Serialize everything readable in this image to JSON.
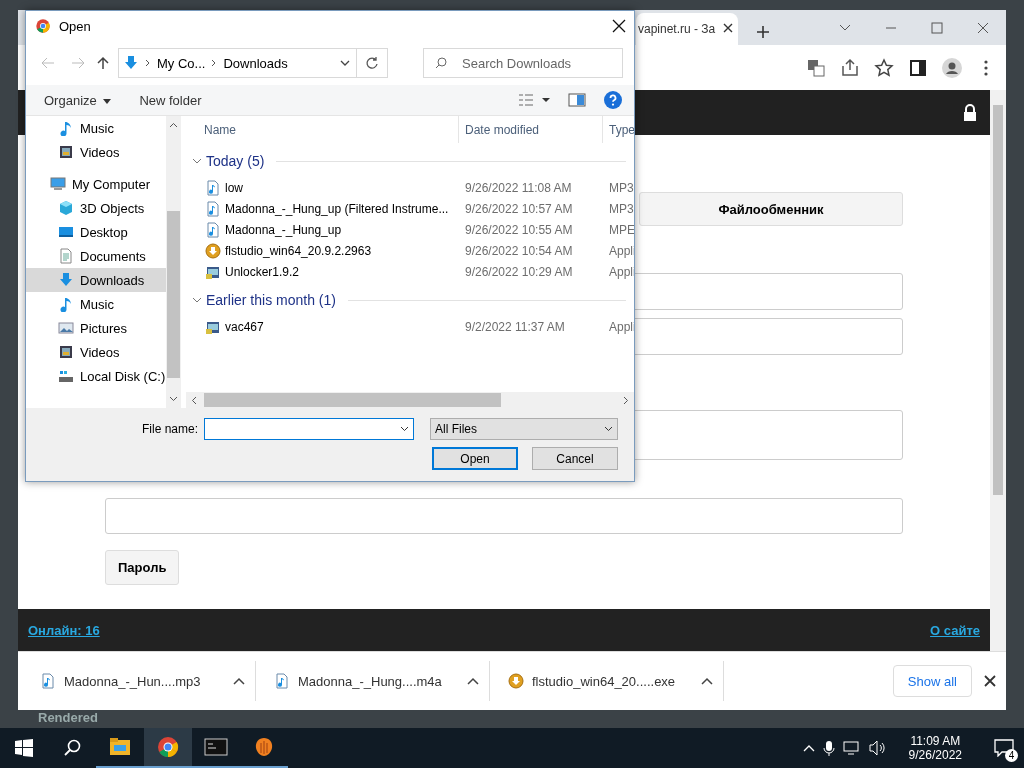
{
  "background_app": {
    "status_text": "Rendered"
  },
  "browser": {
    "tab": {
      "title": "vapinet.ru - За"
    },
    "page": {
      "tab_button": "Файлообменник",
      "password_button": "Пароль",
      "footer": {
        "online_link": "Онлайн: 16",
        "about_link": "О сайте"
      }
    },
    "downloads": {
      "items": [
        {
          "name": "Madonna_-_Hun....mp3",
          "kind": "audio"
        },
        {
          "name": "Madonna_-_Hung....m4a",
          "kind": "audio"
        },
        {
          "name": "flstudio_win64_20.....exe",
          "kind": "installer"
        }
      ],
      "show_all": "Show all"
    }
  },
  "dialog": {
    "title": "Open",
    "breadcrumb": [
      "My Co...",
      "Downloads"
    ],
    "search_placeholder": "Search Downloads",
    "toolbar": {
      "organize": "Organize",
      "new_folder": "New folder"
    },
    "nav": {
      "partial_children": [
        {
          "label": "Music",
          "kind": "music",
          "selected": false
        },
        {
          "label": "Videos",
          "kind": "videos",
          "selected": false
        }
      ],
      "items": [
        {
          "label": "My Computer",
          "kind": "computer",
          "selected": false,
          "children": [
            {
              "label": "3D Objects",
              "kind": "objects3d",
              "selected": false
            },
            {
              "label": "Desktop",
              "kind": "desktop",
              "selected": false
            },
            {
              "label": "Documents",
              "kind": "documents",
              "selected": false
            },
            {
              "label": "Downloads",
              "kind": "downloads",
              "selected": true
            },
            {
              "label": "Music",
              "kind": "music",
              "selected": false
            },
            {
              "label": "Pictures",
              "kind": "pictures",
              "selected": false
            },
            {
              "label": "Videos",
              "kind": "videos",
              "selected": false
            },
            {
              "label": "Local Disk (C:)",
              "kind": "disk",
              "selected": false
            }
          ]
        }
      ]
    },
    "columns": [
      "Name",
      "Date modified",
      "Type"
    ],
    "groups": [
      {
        "title": "Today (5)",
        "expanded": true,
        "files": [
          {
            "name": "low",
            "date": "9/26/2022 11:08 AM",
            "type": "MP3",
            "kind": "audio"
          },
          {
            "name": "Madonna_-_Hung_up (Filtered Instrume...",
            "date": "9/26/2022 10:57 AM",
            "type": "MP3",
            "kind": "audio"
          },
          {
            "name": "Madonna_-_Hung_up",
            "date": "9/26/2022 10:55 AM",
            "type": "MPE",
            "kind": "audio"
          },
          {
            "name": "flstudio_win64_20.9.2.2963",
            "date": "9/26/2022 10:54 AM",
            "type": "Appli",
            "kind": "installer"
          },
          {
            "name": "Unlocker1.9.2",
            "date": "9/26/2022 10:29 AM",
            "type": "Appli",
            "kind": "program"
          }
        ]
      },
      {
        "title": "Earlier this month (1)",
        "expanded": true,
        "files": [
          {
            "name": "vac467",
            "date": "9/2/2022 11:37 AM",
            "type": "Appli",
            "kind": "program"
          }
        ]
      }
    ],
    "file_name_label": "File name:",
    "file_type": "All Files",
    "buttons": [
      "Open",
      "Cancel"
    ]
  },
  "taskbar": {
    "apps": [
      {
        "kind": "explorer",
        "active": false
      },
      {
        "kind": "chrome",
        "active": true
      },
      {
        "kind": "terminal",
        "active": false
      },
      {
        "kind": "flstudio",
        "active": false
      }
    ],
    "time": "11:09 AM",
    "date": "9/26/2022",
    "notifications": "4"
  }
}
